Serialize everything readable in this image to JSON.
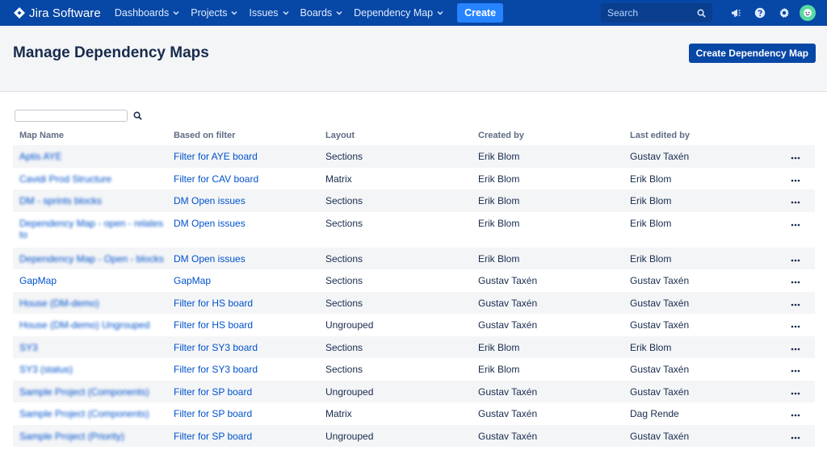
{
  "nav": {
    "brand": "Jira Software",
    "items": [
      {
        "label": "Dashboards"
      },
      {
        "label": "Projects"
      },
      {
        "label": "Issues"
      },
      {
        "label": "Boards"
      },
      {
        "label": "Dependency Map"
      }
    ],
    "create_label": "Create",
    "search_placeholder": "Search"
  },
  "header": {
    "title": "Manage Dependency Maps",
    "create_map_label": "Create Dependency Map"
  },
  "table": {
    "columns": [
      "Map Name",
      "Based on filter",
      "Layout",
      "Created by",
      "Last edited by"
    ],
    "rows": [
      {
        "name": "Aptis AYE",
        "filter": "Filter for AYE board",
        "layout": "Sections",
        "created_by": "Erik Blom",
        "last_edited_by": "Gustav Taxén"
      },
      {
        "name": "Cavidi Prod Structure",
        "filter": "Filter for CAV board",
        "layout": "Matrix",
        "created_by": "Erik Blom",
        "last_edited_by": "Erik Blom"
      },
      {
        "name": "DM - sprints blocks",
        "filter": "DM Open issues",
        "layout": "Sections",
        "created_by": "Erik Blom",
        "last_edited_by": "Erik Blom"
      },
      {
        "name": "Dependency Map - open - relates to",
        "filter": "DM Open issues",
        "layout": "Sections",
        "created_by": "Erik Blom",
        "last_edited_by": "Erik Blom"
      },
      {
        "name": "Dependency Map - Open - blocks",
        "filter": "DM Open issues",
        "layout": "Sections",
        "created_by": "Erik Blom",
        "last_edited_by": "Erik Blom"
      },
      {
        "name": "GapMap",
        "filter": "GapMap",
        "layout": "Sections",
        "created_by": "Gustav Taxén",
        "last_edited_by": "Gustav Taxén"
      },
      {
        "name": "House (DM-demo)",
        "filter": "Filter for HS board",
        "layout": "Sections",
        "created_by": "Gustav Taxén",
        "last_edited_by": "Gustav Taxén"
      },
      {
        "name": "House (DM-demo) Ungrouped",
        "filter": "Filter for HS board",
        "layout": "Ungrouped",
        "created_by": "Gustav Taxén",
        "last_edited_by": "Gustav Taxén"
      },
      {
        "name": "SY3",
        "filter": "Filter for SY3 board",
        "layout": "Sections",
        "created_by": "Erik Blom",
        "last_edited_by": "Erik Blom"
      },
      {
        "name": "SY3 (status)",
        "filter": "Filter for SY3 board",
        "layout": "Sections",
        "created_by": "Erik Blom",
        "last_edited_by": "Gustav Taxén"
      },
      {
        "name": "Sample Project (Components)",
        "filter": "Filter for SP board",
        "layout": "Ungrouped",
        "created_by": "Gustav Taxén",
        "last_edited_by": "Gustav Taxén"
      },
      {
        "name": "Sample Project (Components)",
        "filter": "Filter for SP board",
        "layout": "Matrix",
        "created_by": "Gustav Taxén",
        "last_edited_by": "Dag Rende"
      },
      {
        "name": "Sample Project (Priority)",
        "filter": "Filter for SP board",
        "layout": "Ungrouped",
        "created_by": "Gustav Taxén",
        "last_edited_by": "Gustav Taxén"
      }
    ]
  }
}
